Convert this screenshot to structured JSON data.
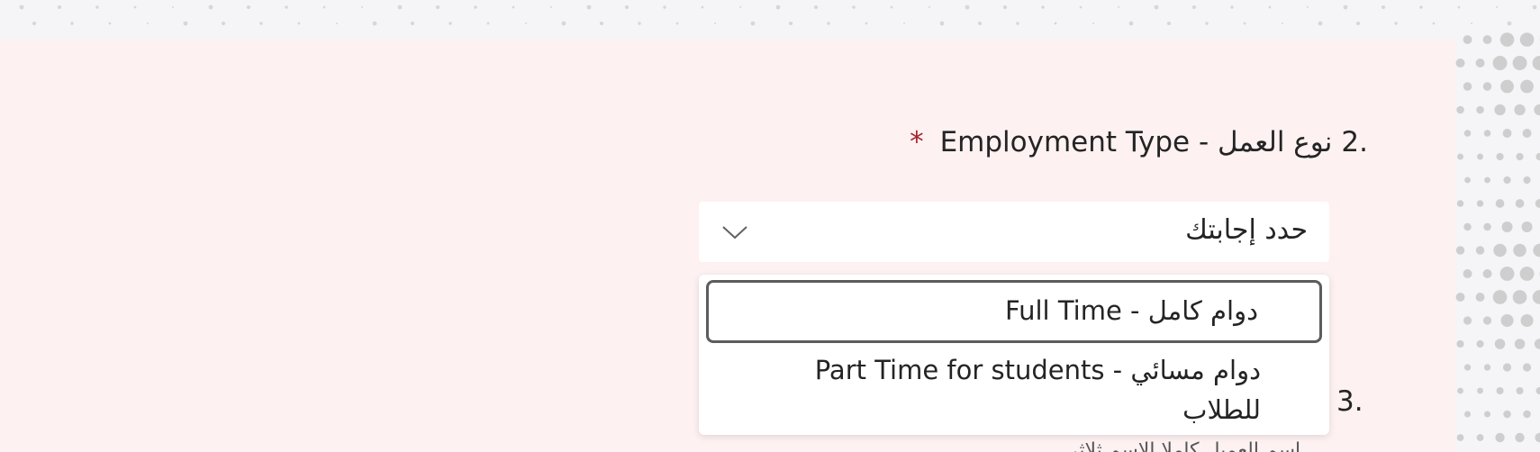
{
  "colors": {
    "page_bg": "#f5f5f7",
    "panel_bg": "#fdf1f1",
    "text": "#242424",
    "required": "#a4262c",
    "focus_border": "#5c5c5c",
    "dots": "#bdbdbd"
  },
  "question": {
    "number": "2.",
    "title": "Employment Type - نوع العمل",
    "required_mark": "*"
  },
  "select": {
    "placeholder": "حدد إجابتك",
    "icon": "chevron-down-icon"
  },
  "dropdown": {
    "options": [
      {
        "label": "Full Time - دوام كامل",
        "focused": true
      },
      {
        "label_line1": "Part Time for students - دوام مسائي",
        "label_line2": "للطلاب",
        "focused": false
      }
    ]
  },
  "next_question": {
    "number": "3.",
    "subtitle": "اسم العميل كاملا الاسم ثلاثي"
  }
}
